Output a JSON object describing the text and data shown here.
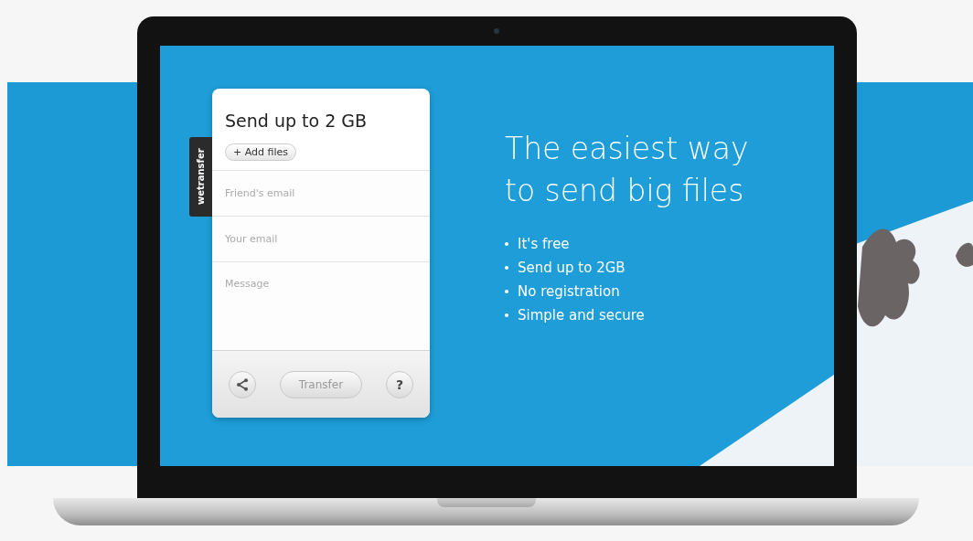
{
  "brand_tab": {
    "label": "wetransfer"
  },
  "upload_card": {
    "title": "Send up to 2 GB",
    "add_files_button": "+ Add files",
    "fields": [
      {
        "kind": "line",
        "placeholder": "Friend's email"
      },
      {
        "kind": "line",
        "placeholder": "Your email"
      },
      {
        "kind": "area",
        "placeholder": "Message"
      }
    ],
    "transfer_button": "Transfer",
    "help_button": "?"
  },
  "hero": {
    "headline": "The easiest way to send big files",
    "features": [
      "It's free",
      "Send up to 2GB",
      "No registration",
      "Simple and secure"
    ]
  }
}
